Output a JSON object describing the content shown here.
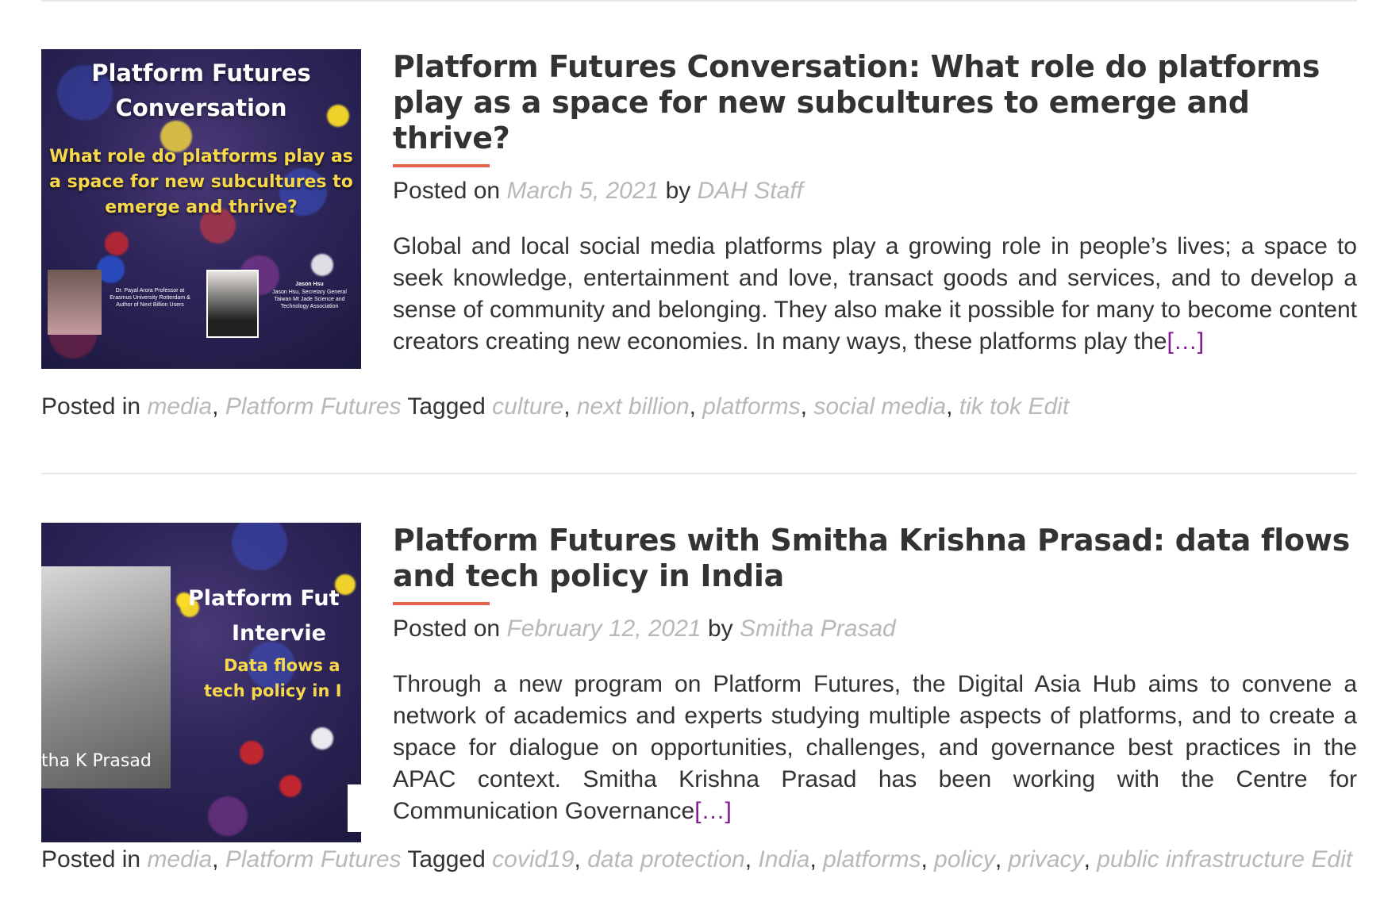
{
  "posts": [
    {
      "thumbnail": {
        "title": "Platform Futures Conversation",
        "subtitle": "What role do platforms play as a space for new subcultures to emerge and thrive?",
        "person1_caption": "Dr. Payal Arora Professor at Erasmus University Rotterdam & Author of Next Billion Users",
        "person2_name": "Jason Hsu",
        "person2_caption": "Jason Hsu, Secretary General Taiwan Mt Jade Science and Technology Association"
      },
      "title": "Platform Futures Conversation: What role do platforms play as a space for new subcultures to emerge and thrive?",
      "posted_on_label": "Posted on",
      "date": "March 5, 2021",
      "by_label": "by",
      "author": "DAH Staff",
      "excerpt": "Global and local social media platforms play a growing role in people’s lives; a space to seek knowledge, entertainment and love, transact goods and services, and to develop a sense of community and belonging. They also make it possible for many to become content creators creating new economies. In many ways, these platforms play the",
      "read_more": "[…]",
      "posted_in_label": "Posted in",
      "categories": [
        "media",
        "Platform Futures"
      ],
      "tagged_label": "Tagged",
      "tags": [
        "culture",
        "next billion",
        "platforms",
        "social media",
        "tik tok"
      ],
      "edit_label": "Edit"
    },
    {
      "thumbnail": {
        "title_line1": "Platform Fut",
        "title_line2": "Intervie",
        "subtitle_line1": "Data flows a",
        "subtitle_line2": "tech policy in I",
        "name_caption": "tha K Prasad"
      },
      "title": "Platform Futures with Smitha Krishna Prasad: data flows and tech policy in India",
      "posted_on_label": "Posted on",
      "date": "February 12, 2021",
      "by_label": "by",
      "author": "Smitha Prasad",
      "excerpt": "Through a new program on Platform Futures, the Digital Asia Hub aims to convene a network of academics and experts studying multiple aspects of platforms, and to create a space for dialogue on opportunities, challenges, and governance best practices in the APAC context. Smitha Krishna Prasad has been working with the Centre for Communication Governance",
      "read_more": "[…]",
      "posted_in_label": "Posted in",
      "categories": [
        "media",
        "Platform Futures"
      ],
      "tagged_label": "Tagged",
      "tags": [
        "covid19",
        "data protection",
        "India",
        "platforms",
        "policy",
        "privacy",
        "public infrastructure"
      ],
      "edit_label": "Edit"
    }
  ],
  "colors": {
    "accent": "#e5634a",
    "link": "#b8b8b8",
    "read_more": "#7d1b8d",
    "text": "#333333"
  }
}
